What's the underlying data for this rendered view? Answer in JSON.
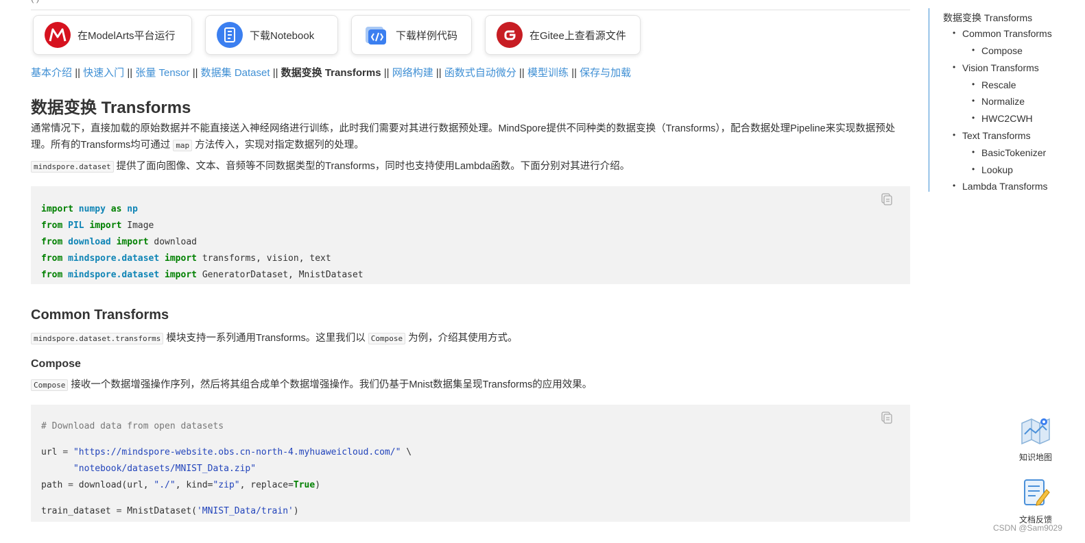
{
  "top_fragment": "(    )",
  "buttons": [
    {
      "label": "在ModelArts平台运行",
      "icon": "modelarts-icon"
    },
    {
      "label": "下载Notebook",
      "icon": "notebook-icon"
    },
    {
      "label": "下载样例代码",
      "icon": "code-icon"
    },
    {
      "label": "在Gitee上查看源文件",
      "icon": "gitee-icon"
    }
  ],
  "breadcrumbs": {
    "items": [
      "基本介绍",
      "快速入门",
      "张量 Tensor",
      "数据集 Dataset",
      "数据变换 Transforms",
      "网络构建",
      "函数式自动微分",
      "模型训练",
      "保存与加载"
    ],
    "separator": "||",
    "current_index": 4
  },
  "page_title": "数据变换 Transforms",
  "intro": {
    "p1_a": "通常情况下，直接加载的原始数据并不能直接送入神经网络进行训练，此时我们需要对其进行数据预处理。MindSpore提供不同种类的数据变换（Transforms），配合数据处理Pipeline来实现数据预处理。所有的Transforms均可通过",
    "p1_code": "map",
    "p1_b": "方法传入，实现对指定数据列的处理。",
    "p2_code": "mindspore.dataset",
    "p2_text": "提供了面向图像、文本、音频等不同数据类型的Transforms，同时也支持使用Lambda函数。下面分别对其进行介绍。"
  },
  "code1": {
    "l1": {
      "k1": "import",
      "m": "numpy",
      "k2": "as",
      "a": "np"
    },
    "l2": {
      "k1": "from",
      "m": "PIL",
      "k2": "import",
      "rest": "Image"
    },
    "l3": {
      "k1": "from",
      "m": "download",
      "k2": "import",
      "rest": "download"
    },
    "l4": {
      "k1": "from",
      "m": "mindspore.dataset",
      "k2": "import",
      "rest": "transforms, vision, text"
    },
    "l5": {
      "k1": "from",
      "m": "mindspore.dataset",
      "k2": "import",
      "rest": "GeneratorDataset, MnistDataset"
    }
  },
  "common": {
    "heading": "Common Transforms",
    "code_a": "mindspore.dataset.transforms",
    "text_a": "模块支持一系列通用Transforms。这里我们以",
    "code_b": "Compose",
    "text_b": "为例，介绍其使用方式。"
  },
  "compose": {
    "heading": "Compose",
    "code": "Compose",
    "text": "接收一个数据增强操作序列，然后将其组合成单个数据增强操作。我们仍基于Mnist数据集呈现Transforms的应用效果。"
  },
  "code2": {
    "comment": "# Download data from open datasets",
    "url_var": "url",
    "url_str1": "\"https://mindspore-website.obs.cn-north-4.myhuaweicloud.com/\"",
    "url_cont": "\\",
    "url_str2": "\"notebook/datasets/MNIST_Data.zip\"",
    "path_pre": "path",
    "path_call": "download(url,",
    "path_arg1": "\"./\"",
    "path_kind": "kind=",
    "path_kindval": "\"zip\"",
    "path_replace": "replace=",
    "path_true": "True",
    "train_pre": "train_dataset",
    "train_call": "MnistDataset(",
    "train_arg": "'MNIST_Data/train'",
    "train_close": ")"
  },
  "toc": {
    "title": "数据变换 Transforms",
    "items": [
      "Common Transforms",
      "Compose",
      "Vision Transforms",
      "Rescale",
      "Normalize",
      "HWC2CWH",
      "Text Transforms",
      "BasicTokenizer",
      "Lookup",
      "Lambda Transforms"
    ]
  },
  "side": {
    "knowledge_map": "知识地图",
    "feedback": "文档反馈"
  },
  "watermark": "CSDN @Sam9029",
  "colors": {
    "link": "#3f8fd4",
    "keyword": "#008000",
    "module": "#0e84b5",
    "string": "#2244bb",
    "code_bg": "#f2f2f2"
  }
}
